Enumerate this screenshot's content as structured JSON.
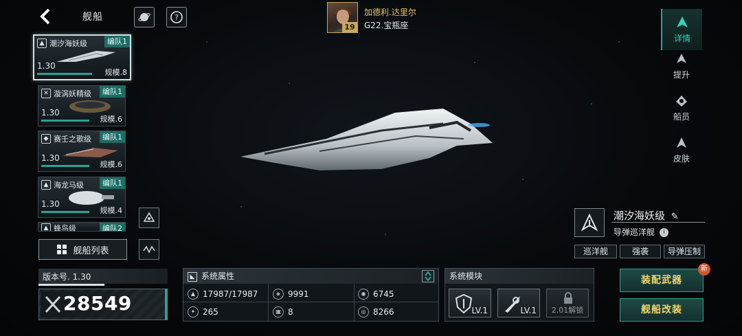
{
  "header": {
    "title": "舰船",
    "player_name": "加德利.达里尔",
    "player_level": "19",
    "player_location": "G22.宝瓶座"
  },
  "ship_list": [
    {
      "name": "潮汐海妖级",
      "team": "编队1",
      "version": "1.30",
      "scale": "规模.8",
      "active": true
    },
    {
      "name": "漩涡妖精级",
      "team": "编队1",
      "version": "1.30",
      "scale": "规模.6",
      "active": false
    },
    {
      "name": "赛壬之歌级",
      "team": "编队1",
      "version": "1.30",
      "scale": "规模.6",
      "active": false
    },
    {
      "name": "海龙马级",
      "team": "编队1",
      "version": "1.30",
      "scale": "规模.4",
      "active": false
    },
    {
      "name": "蜂鸟级",
      "team": "编队2",
      "version": "",
      "scale": "",
      "active": false
    }
  ],
  "ship_list_button": "舰船列表",
  "version": {
    "label": "版本号. 1.30",
    "progress": 0.5
  },
  "combat_power": "28549",
  "attributes": {
    "title": "系统属性",
    "cells": [
      "17987/17987",
      "9991",
      "6745",
      "265",
      "8",
      "8266"
    ]
  },
  "modules": {
    "title": "系统模块",
    "items": [
      {
        "level": "LV.1",
        "icon": "shield-icon"
      },
      {
        "level": "LV.1",
        "icon": "missile-icon"
      },
      {
        "unlock": "2.01解锁",
        "icon": "lock-icon"
      }
    ]
  },
  "right_tabs": [
    {
      "label": "详情",
      "active": true
    },
    {
      "label": "提升",
      "active": false
    },
    {
      "label": "船员",
      "active": false
    },
    {
      "label": "皮肤",
      "active": false
    }
  ],
  "ship": {
    "name": "潮汐海妖级",
    "type": "导弹巡洋舰",
    "tags": [
      "巡洋舰",
      "强袭",
      "导弹压制"
    ]
  },
  "actions": {
    "equip": "装配武器",
    "modify": "舰船改装",
    "new_badge": "新"
  },
  "colors": {
    "accent": "#2aa392",
    "gold": "#e8c66a"
  }
}
